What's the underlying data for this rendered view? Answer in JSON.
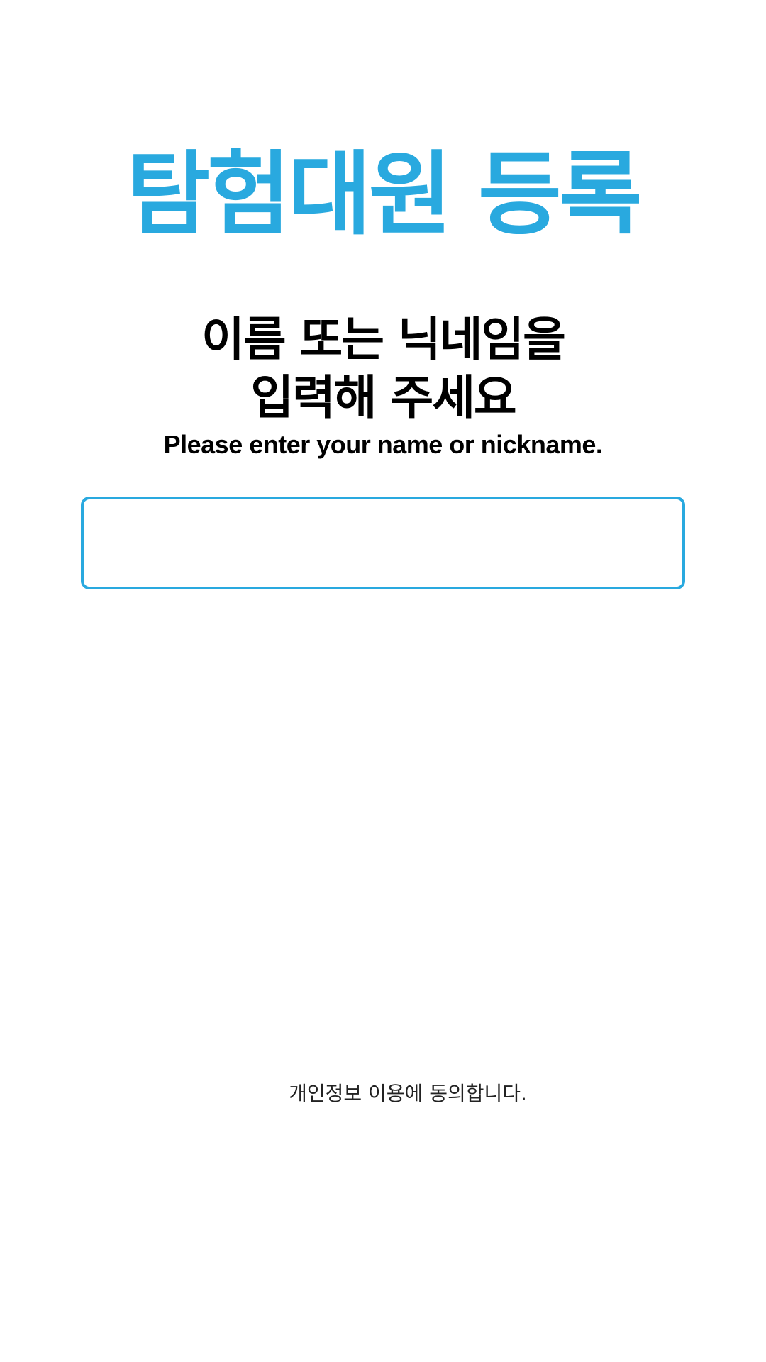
{
  "title": "탐험대원 등록",
  "prompt": {
    "korean_line1": "이름 또는 닉네임을",
    "korean_line2": "입력해 주세요",
    "english": "Please enter your name or nickname."
  },
  "name_input": {
    "value": "",
    "placeholder": ""
  },
  "consent": {
    "label": "개인정보 이용에 동의합니다."
  },
  "colors": {
    "accent": "#29a9df",
    "text": "#000000",
    "background": "#ffffff"
  }
}
